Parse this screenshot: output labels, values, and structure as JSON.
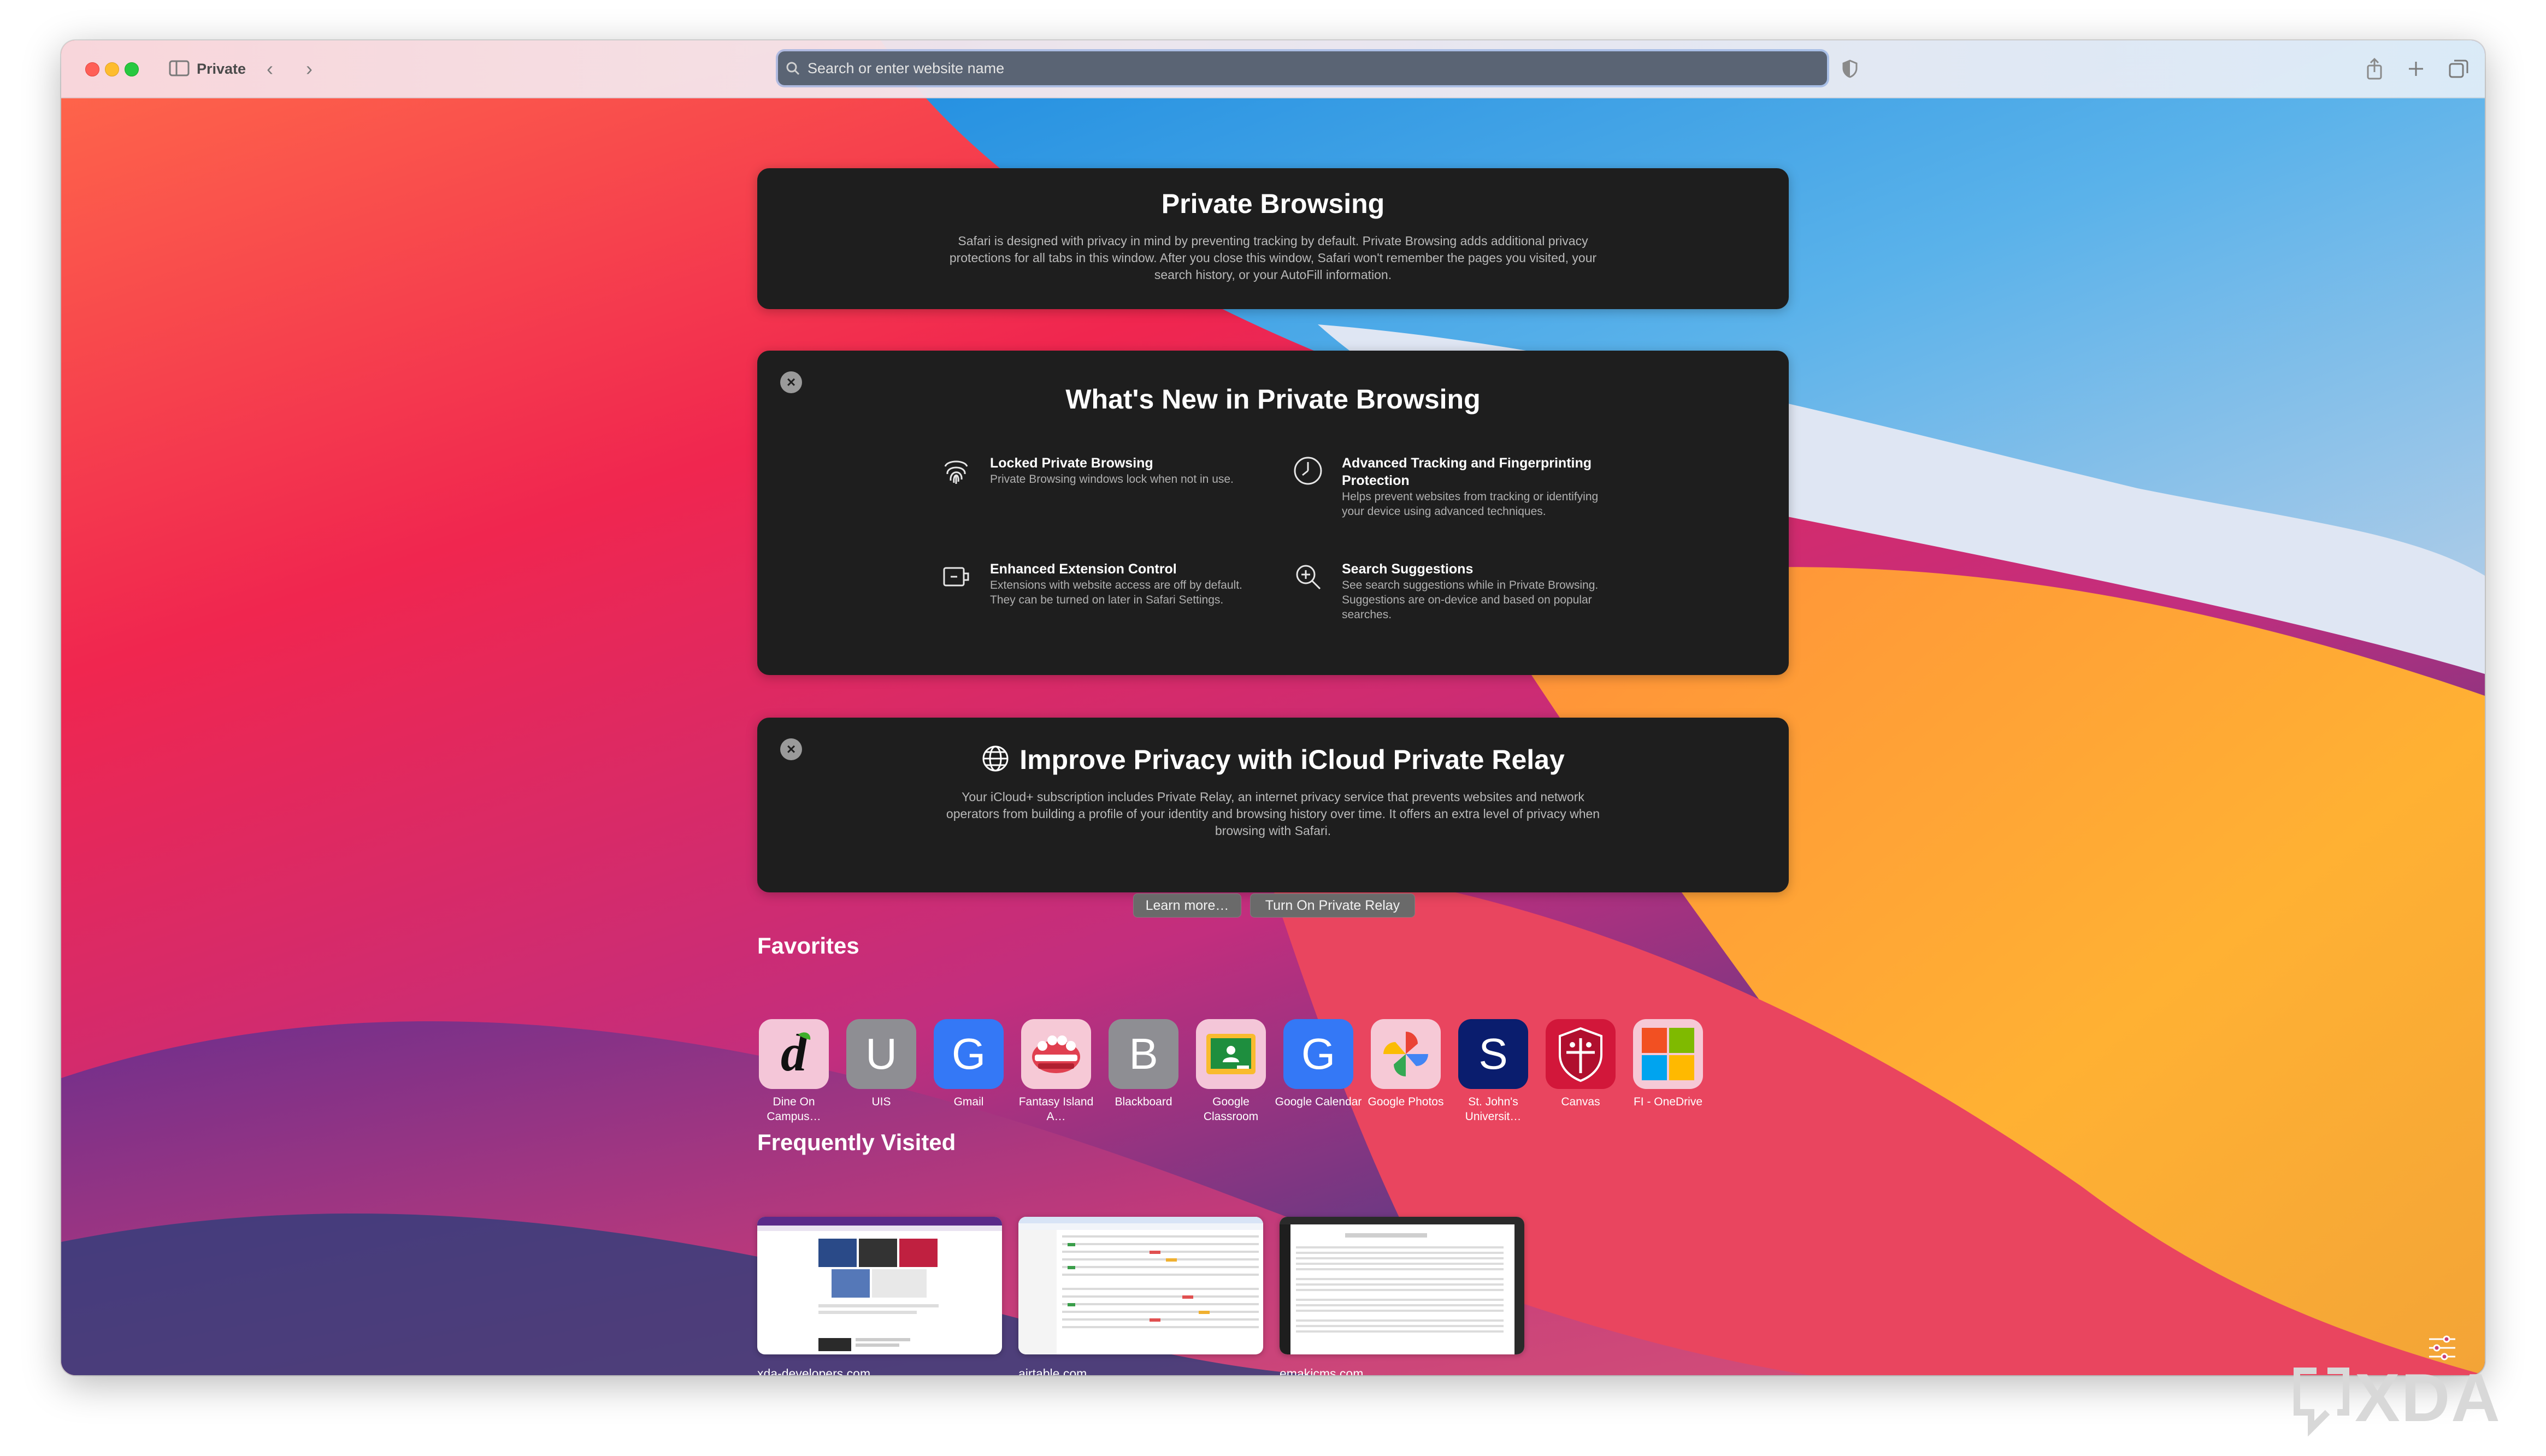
{
  "window": {
    "tab_label": "Private"
  },
  "search": {
    "placeholder": "Search or enter website name"
  },
  "private_browsing": {
    "title": "Private Browsing",
    "body": "Safari is designed with privacy in mind by preventing tracking by default. Private Browsing adds additional privacy protections for all tabs in this window. After you close this window, Safari won't remember the pages you visited, your search history, or your AutoFill information."
  },
  "whats_new": {
    "title": "What's New in Private Browsing",
    "features": [
      {
        "icon": "fingerprint-icon",
        "title": "Locked Private Browsing",
        "desc": "Private Browsing windows lock when not in use."
      },
      {
        "icon": "clock-icon",
        "title": "Advanced Tracking and Fingerprinting Protection",
        "desc": "Helps prevent websites from tracking or identifying your device using advanced techniques."
      },
      {
        "icon": "extension-icon",
        "title": "Enhanced Extension Control",
        "desc": "Extensions with website access are off by default. They can be turned on later in Safari Settings."
      },
      {
        "icon": "search-plus-icon",
        "title": "Search Suggestions",
        "desc": "See search suggestions while in Private Browsing. Suggestions are on-device and based on popular searches."
      }
    ]
  },
  "relay": {
    "title": "Improve Privacy with iCloud Private Relay",
    "body": "Your iCloud+ subscription includes Private Relay, an internet privacy service that prevents websites and network operators from building a profile of your identity and browsing history over time. It offers an extra level of privacy when browsing with Safari.",
    "learn_more": "Learn more…",
    "turn_on": "Turn On Private Relay"
  },
  "favorites": {
    "title": "Favorites",
    "items": [
      {
        "label": "Dine On Campus…",
        "glyph": "d",
        "color": "#f4c6d8"
      },
      {
        "label": "UIS",
        "glyph": "U",
        "color": "#8e8e93"
      },
      {
        "label": "Gmail",
        "glyph": "G",
        "color": "#3478f6"
      },
      {
        "label": "Fantasy Island A…",
        "glyph": "",
        "color": "#f6c9d6"
      },
      {
        "label": "Blackboard",
        "glyph": "B",
        "color": "#8e8e93"
      },
      {
        "label": "Google Classroom",
        "glyph": "",
        "color": "#f4c6d8"
      },
      {
        "label": "Google Calendar",
        "glyph": "G",
        "color": "#3478f6"
      },
      {
        "label": "Google Photos",
        "glyph": "",
        "color": "#f6c9d6"
      },
      {
        "label": "St. John's Universit…",
        "glyph": "S",
        "color": "#0a1d6e"
      },
      {
        "label": "Canvas",
        "glyph": "",
        "color": "#d2173a"
      },
      {
        "label": "FI - OneDrive",
        "glyph": "",
        "color": "#f6c9d6"
      }
    ]
  },
  "frequently_visited": {
    "title": "Frequently Visited",
    "items": [
      {
        "label": "xda-developers.com"
      },
      {
        "label": "airtable.com"
      },
      {
        "label": "emakicms.com"
      }
    ]
  },
  "watermark": {
    "text": "XDA"
  }
}
